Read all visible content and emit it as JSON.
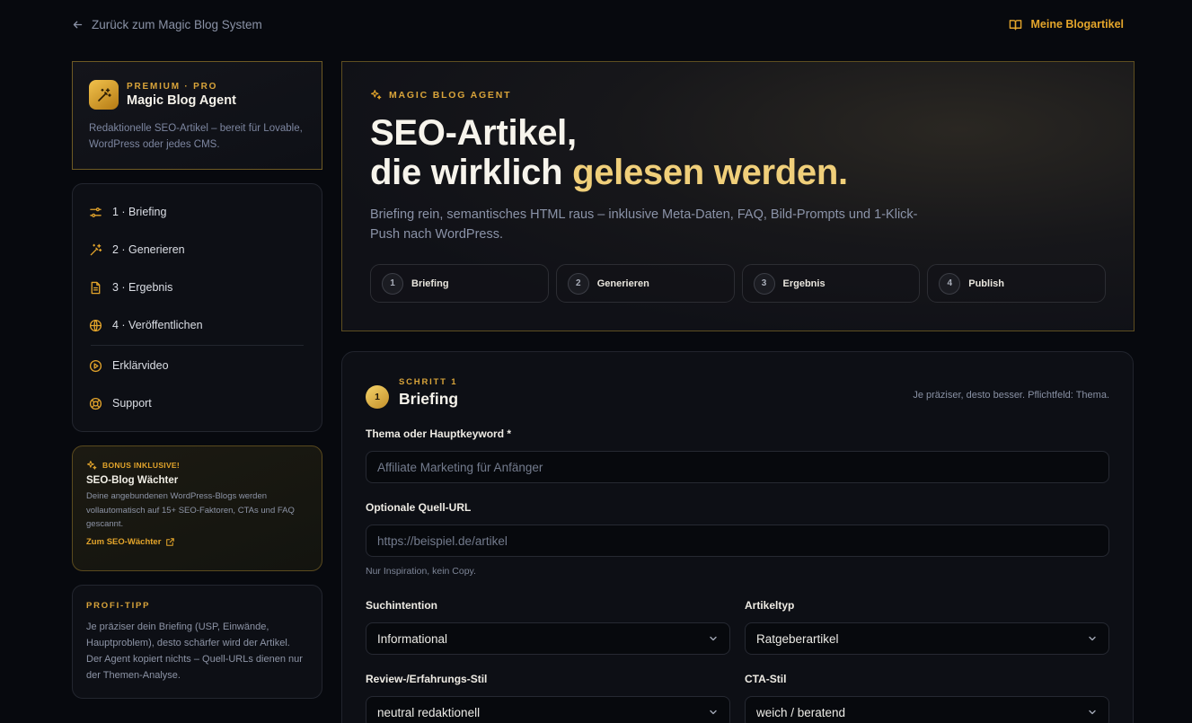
{
  "topbar": {
    "back_label": "Zurück zum Magic Blog System",
    "my_articles_label": "Meine Blogartikel"
  },
  "brand": {
    "eyebrow": "PREMIUM · PRO",
    "name": "Magic Blog Agent",
    "description": "Redaktionelle SEO-Artikel – bereit für Lovable, WordPress oder jedes CMS."
  },
  "sidebar": {
    "items": [
      {
        "label": "1 · Briefing",
        "icon": "sliders-icon"
      },
      {
        "label": "2 · Generieren",
        "icon": "magic-wand-icon"
      },
      {
        "label": "3 · Ergebnis",
        "icon": "document-icon"
      },
      {
        "label": "4 · Veröffentlichen",
        "icon": "globe-icon"
      },
      {
        "label": "Erklärvideo",
        "icon": "play-circle-icon"
      },
      {
        "label": "Support",
        "icon": "lifebuoy-icon"
      }
    ]
  },
  "bonus": {
    "eyebrow": "BONUS INKLUSIVE!",
    "title": "SEO-Blog Wächter",
    "text": "Deine angebundenen WordPress-Blogs werden vollautomatisch auf 15+ SEO-Faktoren, CTAs und FAQ gescannt.",
    "link_label": "Zum SEO-Wächter"
  },
  "tip": {
    "eyebrow": "PROFI-TIPP",
    "text": "Je präziser dein Briefing (USP, Einwände, Hauptproblem), desto schärfer wird der Artikel. Der Agent kopiert nichts – Quell-URLs dienen nur der Themen-Analyse."
  },
  "hero": {
    "eyebrow": "MAGIC BLOG AGENT",
    "title_line1": "SEO-Artikel,",
    "title_line2_plain": "die wirklich ",
    "title_line2_accent": "gelesen werden.",
    "subtitle": "Briefing rein, semantisches HTML raus – inklusive Meta-Daten, FAQ, Bild-Prompts und 1-Klick-Push nach WordPress.",
    "steps": [
      {
        "num": "1",
        "label": "Briefing"
      },
      {
        "num": "2",
        "label": "Generieren"
      },
      {
        "num": "3",
        "label": "Ergebnis"
      },
      {
        "num": "4",
        "label": "Publish"
      }
    ]
  },
  "form": {
    "step_num": "1",
    "eyebrow": "SCHRITT 1",
    "title": "Briefing",
    "hint": "Je präziser, desto besser. Pflichtfeld: Thema.",
    "topic": {
      "label": "Thema oder Hauptkeyword *",
      "placeholder": "Affiliate Marketing für Anfänger",
      "value": ""
    },
    "source_url": {
      "label": "Optionale Quell-URL",
      "placeholder": "https://beispiel.de/artikel",
      "value": "",
      "helper": "Nur Inspiration, kein Copy."
    },
    "search_intent": {
      "label": "Suchintention",
      "value": "Informational"
    },
    "article_type": {
      "label": "Artikeltyp",
      "value": "Ratgeberartikel"
    },
    "review_style": {
      "label": "Review-/Erfahrungs-Stil",
      "value": "neutral redaktionell"
    },
    "cta_style": {
      "label": "CTA-Stil",
      "value": "weich / beratend"
    }
  },
  "colors": {
    "accent": "#e4a52b",
    "background": "#07090e",
    "card": "#0d0f15",
    "gold_border": "#6e5a24"
  }
}
